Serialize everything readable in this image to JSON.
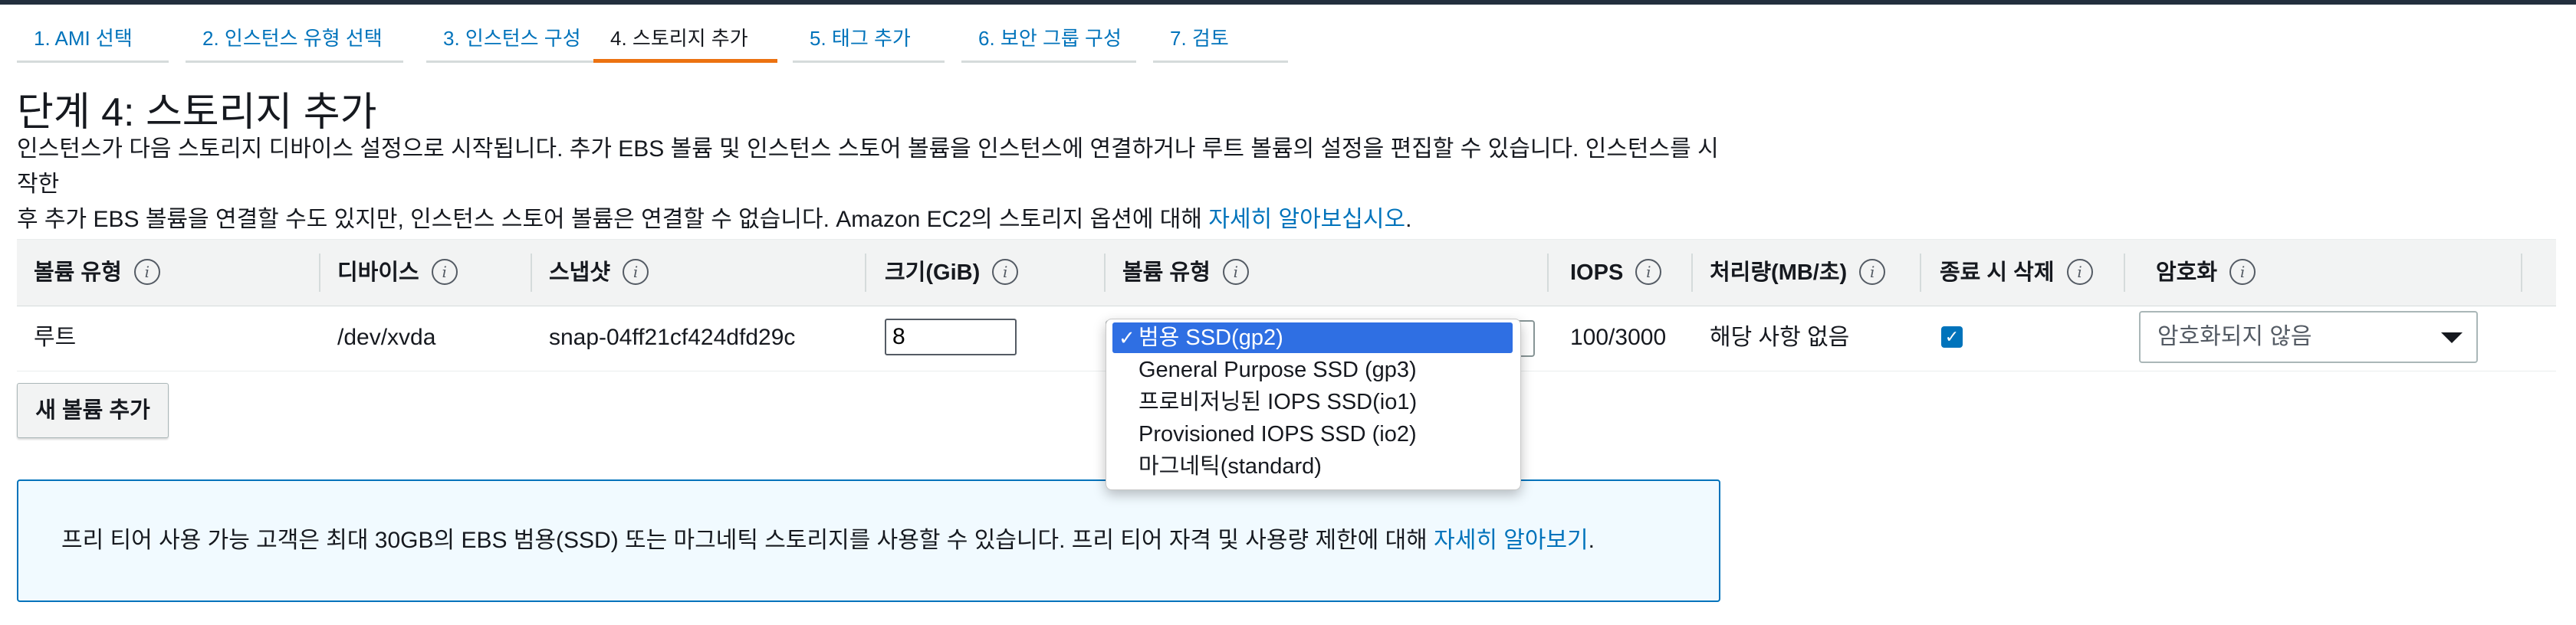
{
  "tabs": [
    {
      "label": "1. AMI 선택"
    },
    {
      "label": "2. 인스턴스 유형 선택"
    },
    {
      "label": "3. 인스턴스 구성"
    },
    {
      "label": "4. 스토리지 추가"
    },
    {
      "label": "5. 태그 추가"
    },
    {
      "label": "6. 보안 그룹 구성"
    },
    {
      "label": "7. 검토"
    }
  ],
  "page": {
    "title": "단계 4: 스토리지 추가",
    "desc_line1": "인스턴스가 다음 스토리지 디바이스 설정으로 시작됩니다. 추가 EBS 볼륨 및 인스턴스 스토어 볼륨을 인스턴스에 연결하거나 루트 볼륨의 설정을 편집할 수 있습니다. 인스턴스를 시작한",
    "desc_line2": "후 추가 EBS 볼륨을 연결할 수도 있지만, 인스턴스 스토어 볼륨은 연결할 수 없습니다. Amazon EC2의 스토리지 옵션에 대해 ",
    "desc_link": "자세히 알아보십시오",
    "desc_end": "."
  },
  "table": {
    "headers": [
      "볼륨 유형",
      "디바이스",
      "스냅샷",
      "크기(GiB)",
      "볼륨 유형",
      "IOPS",
      "처리량(MB/초)",
      "종료 시 삭제",
      "암호화"
    ],
    "info_glyph": "i",
    "row": {
      "volume_kind": "루트",
      "device": "/dev/xvda",
      "snapshot": "snap-04ff21cf424dfd29c",
      "size": "8",
      "iops": "100/3000",
      "throughput": "해당 사항 없음",
      "delete_on_termination": true,
      "encryption": "암호화되지 않음"
    }
  },
  "volume_type_dropdown": {
    "options": [
      "범용 SSD(gp2)",
      "General Purpose SSD (gp3)",
      "프로비저닝된 IOPS SSD(io1)",
      "Provisioned IOPS SSD (io2)",
      "마그네틱(standard)"
    ],
    "selected_index": 0,
    "check_glyph": "✓"
  },
  "buttons": {
    "add_volume": "새 볼륨 추가"
  },
  "notice": {
    "text": "프리 티어 사용 가능 고객은 최대 30GB의 EBS 범용(SSD) 또는 마그네틱 스토리지를 사용할 수 있습니다. 프리 티어 자격 및 사용량 제한에 대해 ",
    "link": "자세히 알아보기",
    "end": "."
  },
  "colors": {
    "accent_tab": "#ec7211",
    "link": "#0073bb",
    "selected_option": "#2f6fe3"
  }
}
